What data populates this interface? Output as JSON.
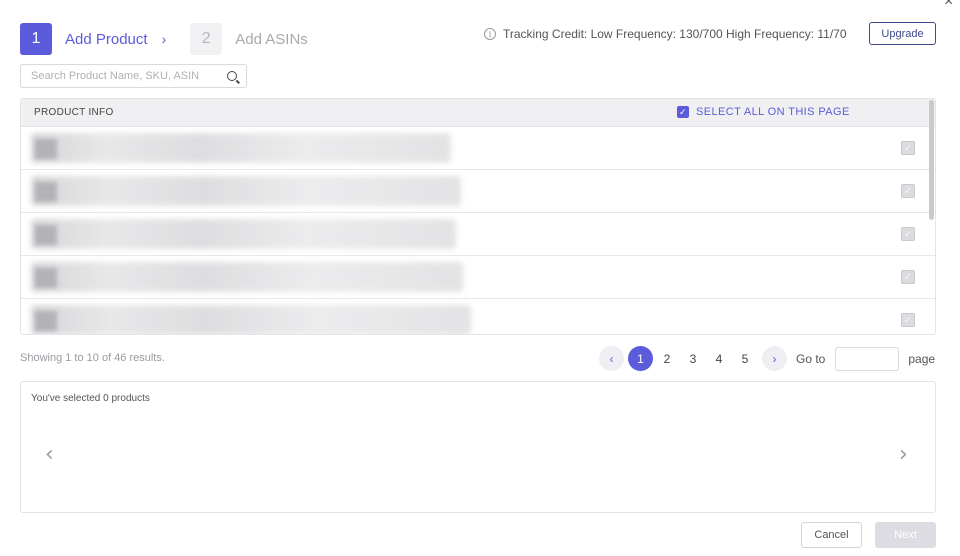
{
  "steps": [
    {
      "number": "1",
      "label": "Add Product",
      "state": "active"
    },
    {
      "number": "2",
      "label": "Add ASINs",
      "state": "inactive"
    }
  ],
  "step_separator": "›",
  "close_glyph": "×",
  "tracking_credit": "Tracking Credit: Low Frequency: 130/700 High Frequency: 11/70",
  "upgrade_label": "Upgrade",
  "search": {
    "placeholder": "Search Product Name, SKU, ASIN"
  },
  "table": {
    "header_label": "PRODUCT INFO",
    "select_all_label": "SELECT ALL ON THIS PAGE",
    "select_all_checked": true,
    "rows": [
      {
        "row_checkbox": "checked-disabled"
      },
      {
        "row_checkbox": "checked-disabled"
      },
      {
        "row_checkbox": "checked-disabled"
      },
      {
        "row_checkbox": "checked-disabled"
      },
      {
        "row_checkbox": "checked-disabled"
      }
    ]
  },
  "pagination": {
    "summary": "Showing 1 to 10 of 46 results.",
    "prev_glyph": "‹",
    "next_glyph": "›",
    "pages": [
      "1",
      "2",
      "3",
      "4",
      "5"
    ],
    "current_page": "1",
    "goto_label": "Go to",
    "page_label": "page"
  },
  "selected_summary": "You've selected 0 products",
  "carousel": {
    "prev_glyph": "‹",
    "next_glyph": "›"
  },
  "footer": {
    "cancel_label": "Cancel",
    "next_label": "Next"
  },
  "colors": {
    "accent": "#5b5bdb",
    "upgrade_border": "#3f4a8c",
    "disabled_button": "#dcdce2"
  }
}
